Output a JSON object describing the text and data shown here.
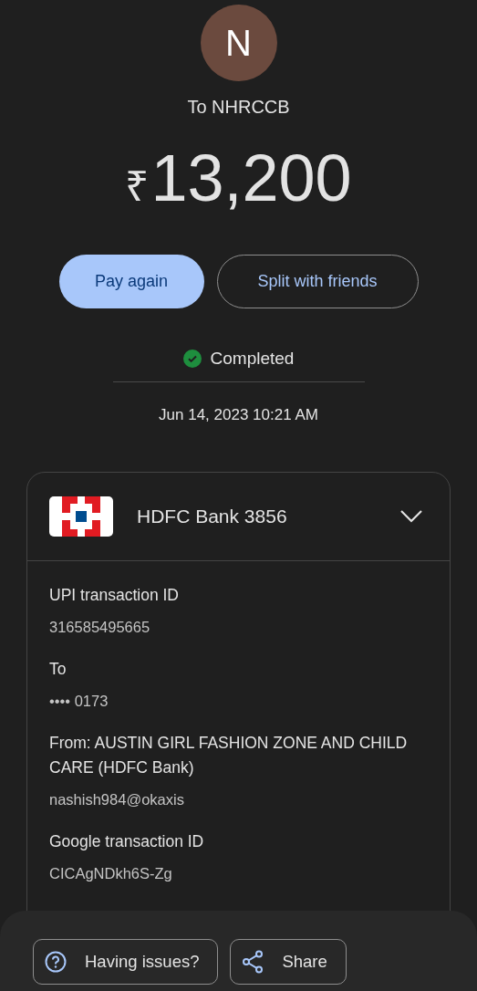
{
  "payee": {
    "avatar_letter": "N",
    "name": "To NHRCCB"
  },
  "amount": {
    "currency": "₹",
    "value": "13,200"
  },
  "actions": [
    "Pay again",
    "Split with friends"
  ],
  "status": "Completed",
  "datetime": "Jun 14, 2023 10:21 AM",
  "account": {
    "bank": "HDFC Bank 3856"
  },
  "details": [
    {
      "label": "UPI transaction ID",
      "lines": [
        "316585495665"
      ]
    },
    {
      "label": "To",
      "lines": [
        "•••• 0173"
      ]
    },
    {
      "label": "From: AUSTIN GIRL FASHION ZONE AND CHILD CARE (HDFC Bank)",
      "lines": [
        "nashish984@okaxis"
      ]
    },
    {
      "label": "Google transaction ID",
      "lines": [
        "CICAgNDkh6S-Zg"
      ]
    }
  ],
  "bottom_bar": [
    {
      "kind": "help",
      "label": "Having issues?"
    },
    {
      "kind": "share",
      "label": "Share"
    }
  ]
}
